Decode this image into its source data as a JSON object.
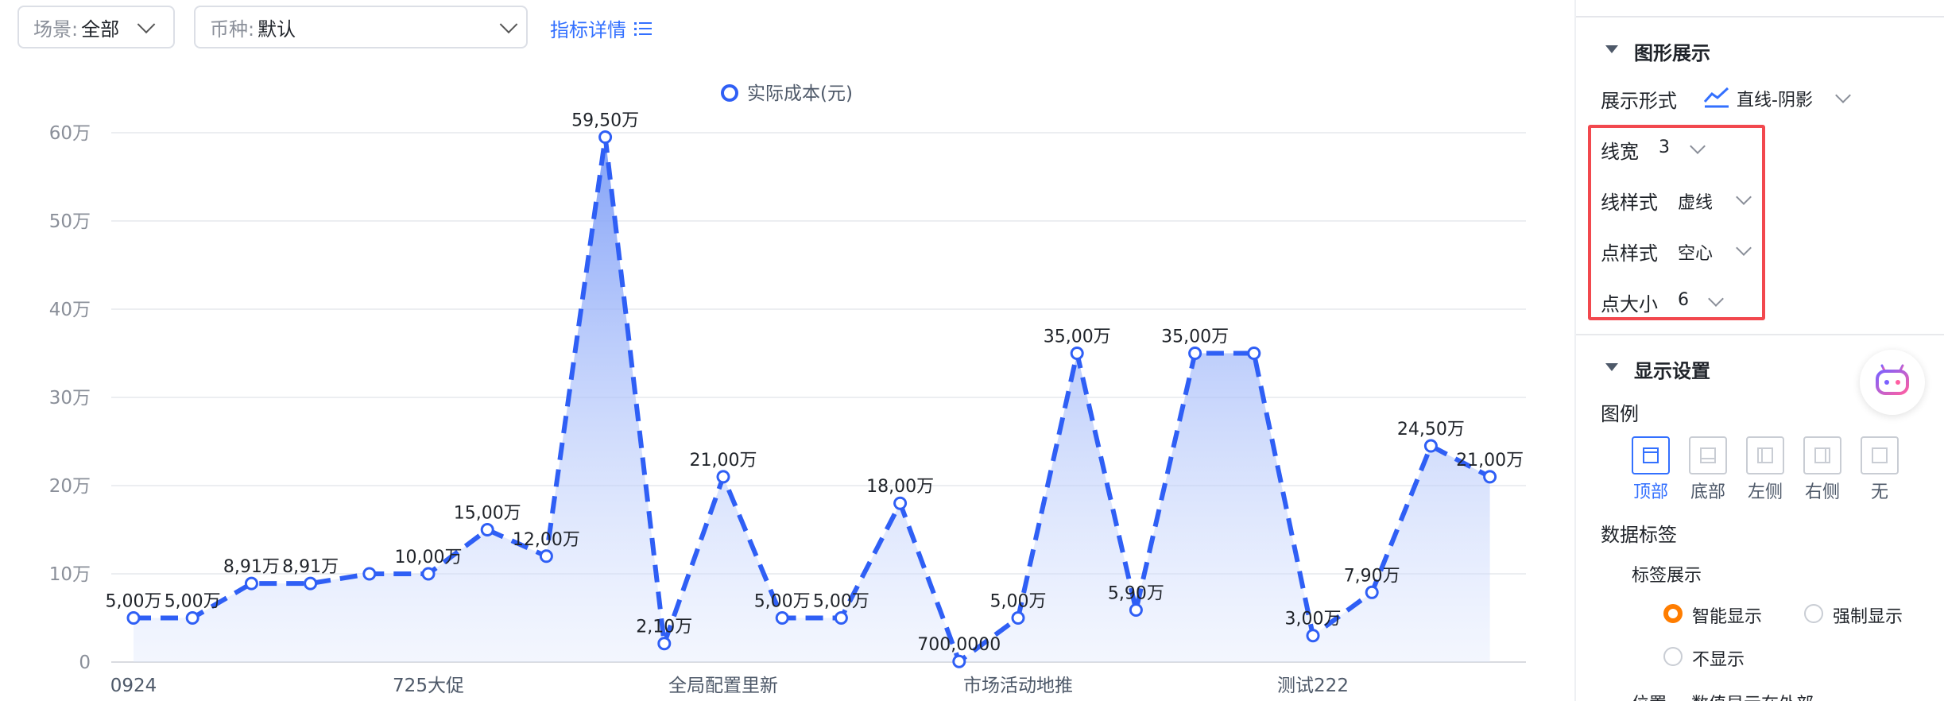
{
  "filters": {
    "scene": {
      "label": "场景:",
      "value": "全部"
    },
    "currency": {
      "label": "币种:",
      "value": "默认"
    },
    "detail_link": "指标详情"
  },
  "chart_data": {
    "type": "area",
    "line_style": "dashed",
    "point_style": "hollow",
    "color": "#2f5ff5",
    "legend": {
      "label": "实际成本(元)",
      "position": "top"
    },
    "grid": true,
    "ylim": [
      0,
      600000
    ],
    "y_ticks": [
      {
        "value": 0,
        "label": "0"
      },
      {
        "value": 100000,
        "label": "10万"
      },
      {
        "value": 200000,
        "label": "20万"
      },
      {
        "value": 300000,
        "label": "30万"
      },
      {
        "value": 400000,
        "label": "40万"
      },
      {
        "value": 500000,
        "label": "50万"
      },
      {
        "value": 600000,
        "label": "60万"
      }
    ],
    "x_tick_labels": [
      {
        "index": 0,
        "label": "0924"
      },
      {
        "index": 5,
        "label": "725大促"
      },
      {
        "index": 10,
        "label": "全局配置里新"
      },
      {
        "index": 15,
        "label": "市场活动地推"
      },
      {
        "index": 20,
        "label": "测试222"
      }
    ],
    "series": [
      {
        "values": [
          50000,
          50000,
          89100,
          89100,
          100000,
          100000,
          150000,
          120000,
          595000,
          21000,
          210000,
          50000,
          50000,
          180000,
          700,
          50000,
          350000,
          59000,
          350000,
          350000,
          30000,
          79000,
          245000,
          210000
        ],
        "labels": [
          "5,00万",
          "5,00万",
          "8,91万",
          "8,91万",
          "",
          "10,00万",
          "15,00万",
          "12,00万",
          "59,50万",
          "2,10万",
          "21,00万",
          "5,00万",
          "5,00万",
          "18,00万",
          "700,0000",
          "5,00万",
          "35,00万",
          "5,90万",
          "35,00万",
          "",
          "3,00万",
          "7,90万",
          "24,50万",
          "21,00万"
        ]
      }
    ]
  },
  "panel": {
    "graph_section": "图形展示",
    "display_mode": {
      "label": "展示形式",
      "value": "直线-阴影"
    },
    "line_width": {
      "label": "线宽",
      "value": "3"
    },
    "line_style": {
      "label": "线样式",
      "value": "虚线"
    },
    "point_style": {
      "label": "点样式",
      "value": "空心"
    },
    "point_size": {
      "label": "点大小",
      "value": "6"
    },
    "display_section": "显示设置",
    "legend_label": "图例",
    "legend_positions": [
      "顶部",
      "底部",
      "左侧",
      "右侧",
      "无"
    ],
    "data_labels": "数据标签",
    "label_display": "标签展示",
    "radio_options": [
      "智能显示",
      "强制显示",
      "不显示"
    ],
    "bottom_row": {
      "label": "位置",
      "value": "数值显示在外部"
    }
  }
}
